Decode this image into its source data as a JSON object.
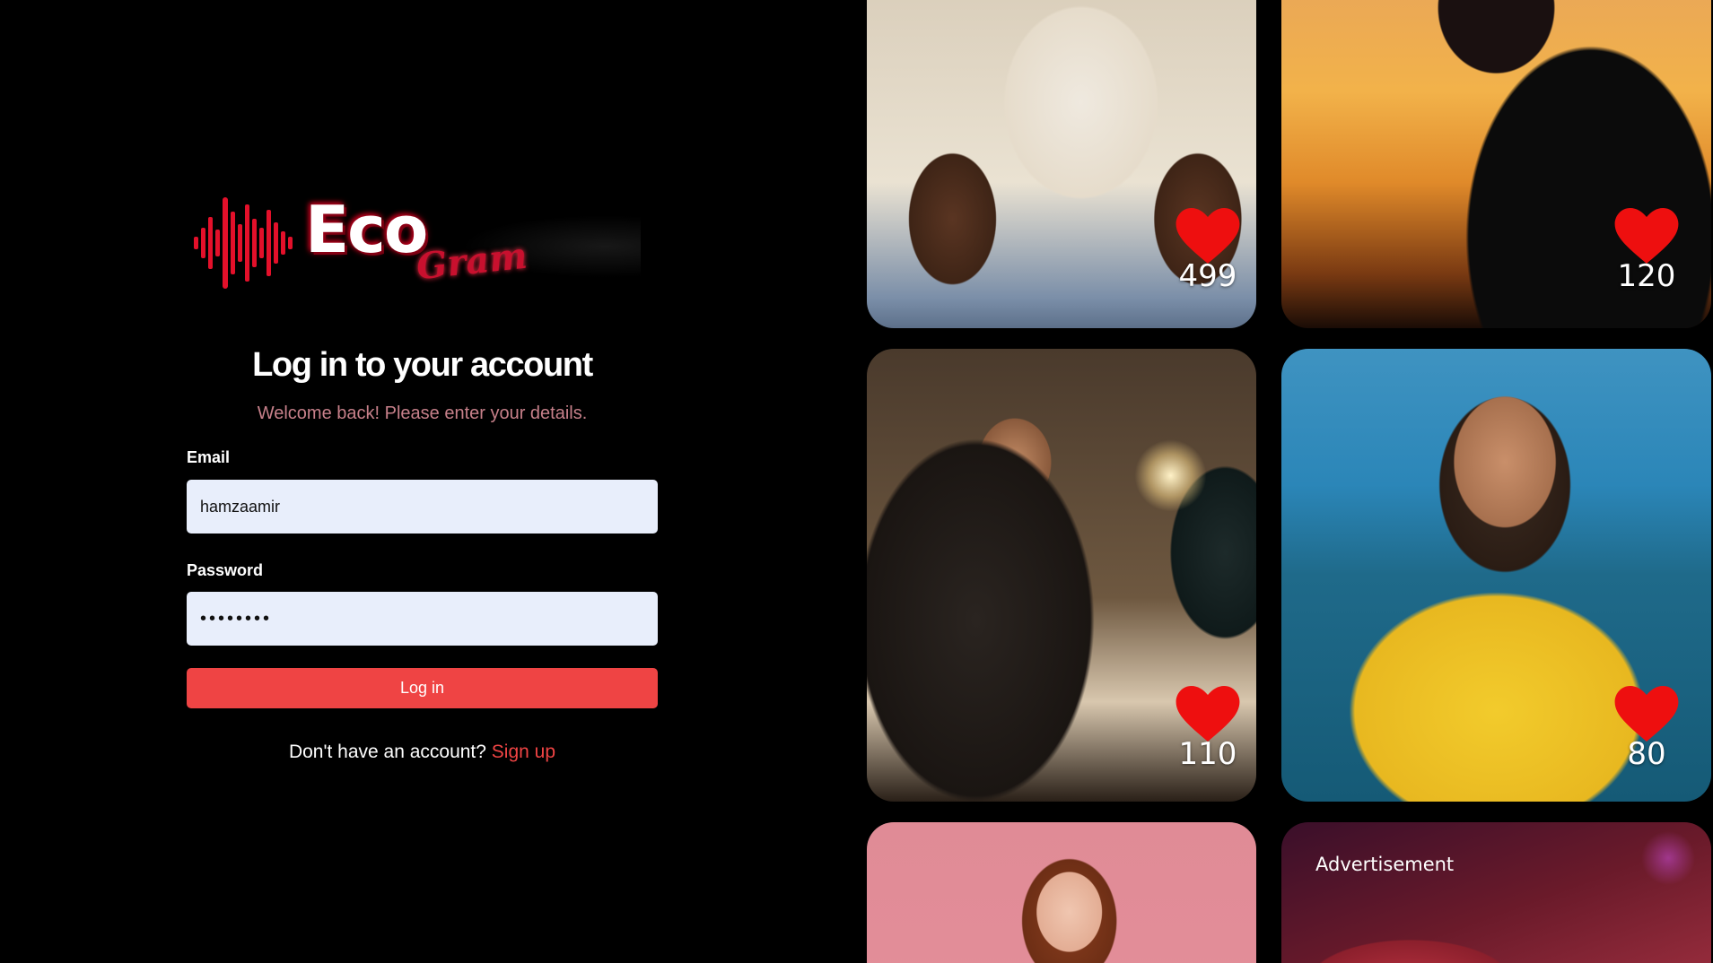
{
  "brand": {
    "name_main": "Eco",
    "name_script": "Gram",
    "accent": "#c8102e"
  },
  "login": {
    "title": "Log in to your account",
    "subtitle": "Welcome back! Please enter your details.",
    "email_label": "Email",
    "email_value": "hamzaamir",
    "password_label": "Password",
    "password_value": "••••••••",
    "submit_label": "Log in",
    "signup_prompt": "Don't have an account?",
    "signup_link": "Sign up",
    "button_color": "#ef4444",
    "input_bg": "#e8eefb"
  },
  "feed": {
    "cards": [
      {
        "likes": "499",
        "icon": "heart-icon"
      },
      {
        "likes": "120",
        "icon": "heart-icon"
      },
      {
        "likes": "110",
        "icon": "heart-icon"
      },
      {
        "likes": "80",
        "icon": "heart-icon"
      }
    ],
    "ad_label": "Advertisement",
    "heart_color": "#ee0f0f"
  }
}
